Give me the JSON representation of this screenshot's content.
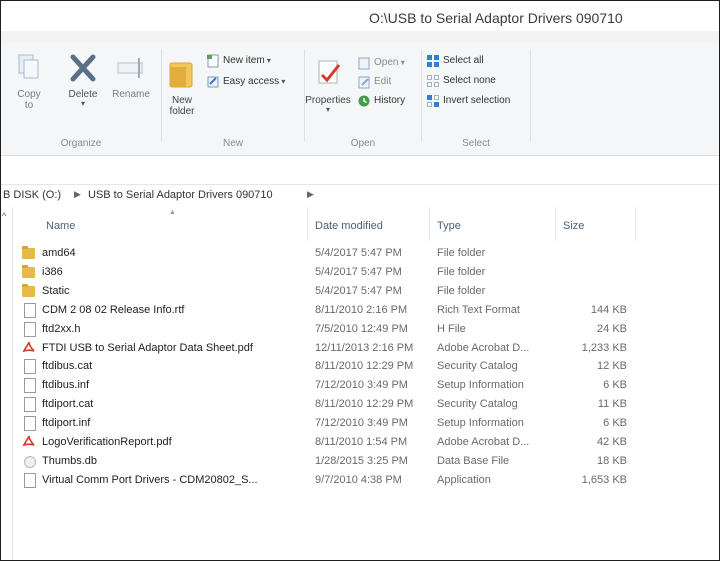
{
  "window": {
    "title": "O:\\USB to Serial Adaptor Drivers 090710"
  },
  "ribbon": {
    "organize": {
      "label": "Organize",
      "copy_to": "Copy to",
      "delete": "Delete",
      "rename": "Rename"
    },
    "new": {
      "label": "New",
      "new_folder": "New folder",
      "new_item": "New item",
      "easy_access": "Easy access"
    },
    "open": {
      "label": "Open",
      "properties": "Properties",
      "open": "Open",
      "edit": "Edit",
      "history": "History"
    },
    "select": {
      "label": "Select",
      "select_all": "Select all",
      "select_none": "Select none",
      "invert_selection": "Invert selection"
    }
  },
  "address": {
    "crumbs": [
      "B DISK (O:)",
      "USB to Serial Adaptor Drivers 090710"
    ]
  },
  "columns": {
    "name": "Name",
    "date": "Date modified",
    "type": "Type",
    "size": "Size"
  },
  "files": [
    {
      "icon": "folder-icon",
      "name": "amd64",
      "date": "5/4/2017 5:47 PM",
      "type": "File folder",
      "size": ""
    },
    {
      "icon": "folder-icon",
      "name": "i386",
      "date": "5/4/2017 5:47 PM",
      "type": "File folder",
      "size": ""
    },
    {
      "icon": "folder-icon",
      "name": "Static",
      "date": "5/4/2017 5:47 PM",
      "type": "File folder",
      "size": ""
    },
    {
      "icon": "document-icon",
      "name": "CDM 2 08 02 Release Info.rtf",
      "date": "8/11/2010 2:16 PM",
      "type": "Rich Text Format",
      "size": "144 KB"
    },
    {
      "icon": "document-icon",
      "name": "ftd2xx.h",
      "date": "7/5/2010 12:49 PM",
      "type": "H File",
      "size": "24 KB"
    },
    {
      "icon": "pdf-icon",
      "name": "FTDI USB to Serial Adaptor Data Sheet.pdf",
      "date": "12/11/2013 2:16 PM",
      "type": "Adobe Acrobat D...",
      "size": "1,233 KB"
    },
    {
      "icon": "document-icon",
      "name": "ftdibus.cat",
      "date": "8/11/2010 12:29 PM",
      "type": "Security Catalog",
      "size": "12 KB"
    },
    {
      "icon": "document-icon",
      "name": "ftdibus.inf",
      "date": "7/12/2010 3:49 PM",
      "type": "Setup Information",
      "size": "6 KB"
    },
    {
      "icon": "document-icon",
      "name": "ftdiport.cat",
      "date": "8/11/2010 12:29 PM",
      "type": "Security Catalog",
      "size": "11 KB"
    },
    {
      "icon": "document-icon",
      "name": "ftdiport.inf",
      "date": "7/12/2010 3:49 PM",
      "type": "Setup Information",
      "size": "6 KB"
    },
    {
      "icon": "pdf-icon",
      "name": "LogoVerificationReport.pdf",
      "date": "8/11/2010 1:54 PM",
      "type": "Adobe Acrobat D...",
      "size": "42 KB"
    },
    {
      "icon": "database-icon",
      "name": "Thumbs.db",
      "date": "1/28/2015 3:25 PM",
      "type": "Data Base File",
      "size": "18 KB"
    },
    {
      "icon": "application-icon",
      "name": "Virtual Comm Port Drivers - CDM20802_S...",
      "date": "9/7/2010 4:38 PM",
      "type": "Application",
      "size": "1,653 KB"
    }
  ]
}
